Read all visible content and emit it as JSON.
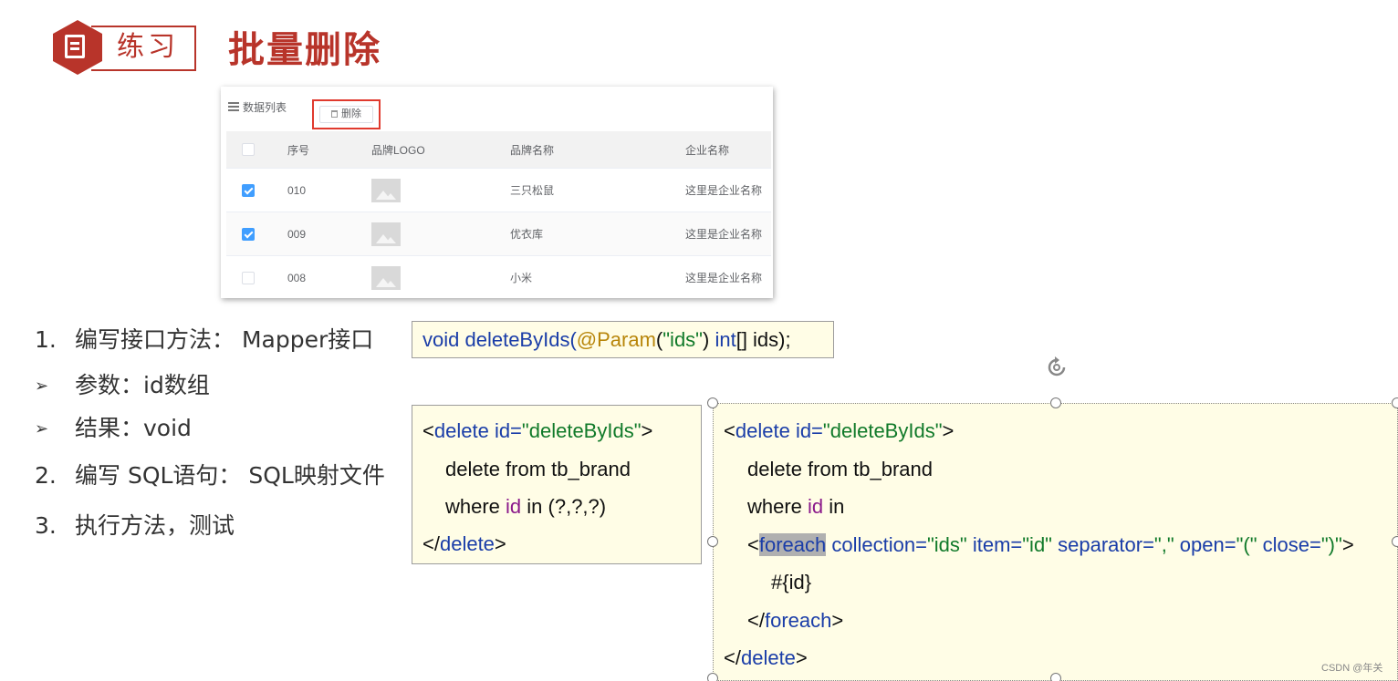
{
  "header": {
    "tag": "练习",
    "title": "批量删除"
  },
  "table_ui": {
    "list_label": "数据列表",
    "delete_button": "删除",
    "columns": [
      "序号",
      "品牌LOGO",
      "品牌名称",
      "企业名称"
    ],
    "rows": [
      {
        "checked": true,
        "id": "010",
        "brand": "三只松鼠",
        "company": "这里是企业名称"
      },
      {
        "checked": true,
        "id": "009",
        "brand": "优衣库",
        "company": "这里是企业名称"
      },
      {
        "checked": false,
        "id": "008",
        "brand": "小米",
        "company": "这里是企业名称"
      }
    ]
  },
  "steps": [
    {
      "marker": "1.",
      "text": "编写接口方法： Mapper接口"
    },
    {
      "marker": "➢",
      "text": "参数：id数组"
    },
    {
      "marker": "➢",
      "text": "结果：void"
    },
    {
      "marker": "2.",
      "text": "编写 SQL语句： SQL映射文件"
    },
    {
      "marker": "3.",
      "text": "执行方法，测试"
    }
  ],
  "code": {
    "signature": {
      "void": "void",
      "method": "deleteByIds(",
      "annotation": "@Param",
      "open_paren": "(",
      "param_str": "\"ids\"",
      "close_paren": ") ",
      "int": "int",
      "rest": "[] ids);"
    },
    "box2": {
      "l1_lt": "<",
      "l1_tag": "delete",
      "l1_attr": "id=",
      "l1_val": "\"deleteByIds\"",
      "l1_gt": ">",
      "l2": "delete from tb_brand",
      "l3_where": "where ",
      "l3_id": "id",
      "l3_rest": " in (?,?,?)",
      "l4_lt": "</",
      "l4_tag": "delete",
      "l4_gt": ">"
    },
    "box3": {
      "l1_lt": "<",
      "l1_tag": "delete",
      "l1_attr": "id=",
      "l1_val": "\"deleteByIds\"",
      "l1_gt": ">",
      "l2": "delete from tb_brand",
      "l3_where": "where ",
      "l3_id": "id",
      "l3_rest": " in",
      "l4_lt": "<",
      "l4_tag": "foreach",
      "l4_attr1": "collection=",
      "l4_val1": "\"ids\"",
      "l4_attr2": "item=",
      "l4_val2": "\"id\"",
      "l4_attr3": "separator=",
      "l4_val3": "\",\"",
      "l4_attr4": "open=",
      "l4_val4": "\"(\"",
      "l4_attr5": "close=",
      "l4_val5": "\")\"",
      "l4_gt": ">",
      "l5": "#{id}",
      "l6_lt": "</",
      "l6_tag": "foreach",
      "l6_gt": ">",
      "l7_lt": "</",
      "l7_tag": "delete",
      "l7_gt": ">"
    }
  },
  "watermark": "CSDN @年关",
  "colors": {
    "brand_red": "#b8342a",
    "code_bg": "#fffde6",
    "checkbox_blue": "#409eff"
  }
}
